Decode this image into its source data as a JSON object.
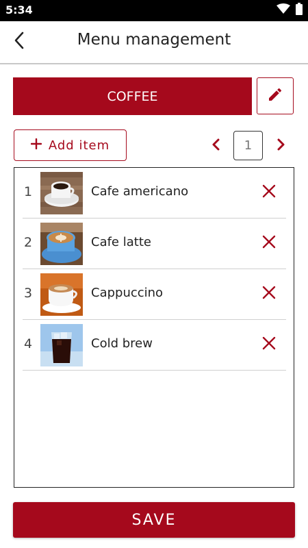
{
  "status_bar": {
    "time": "5:34",
    "icons": [
      "wifi-icon",
      "battery-icon"
    ]
  },
  "header": {
    "title": "Menu management",
    "back_icon": "chevron-left-icon"
  },
  "category": {
    "name": "COFFEE",
    "edit_icon": "pencil-icon"
  },
  "toolbar": {
    "add_item_label": "Add item",
    "add_icon": "plus-icon"
  },
  "pager": {
    "current_page": "1",
    "prev_icon": "chevron-left-icon",
    "next_icon": "chevron-right-icon"
  },
  "items": [
    {
      "number": "1",
      "name": "Cafe americano",
      "thumb": "americano-photo"
    },
    {
      "number": "2",
      "name": "Cafe latte",
      "thumb": "latte-photo"
    },
    {
      "number": "3",
      "name": "Cappuccino",
      "thumb": "cappuccino-photo"
    },
    {
      "number": "4",
      "name": "Cold brew",
      "thumb": "cold-brew-photo"
    }
  ],
  "footer": {
    "save_label": "SAVE"
  },
  "colors": {
    "accent": "#a5091c",
    "status_bar": "#000000",
    "divider": "#c8c8c8"
  }
}
